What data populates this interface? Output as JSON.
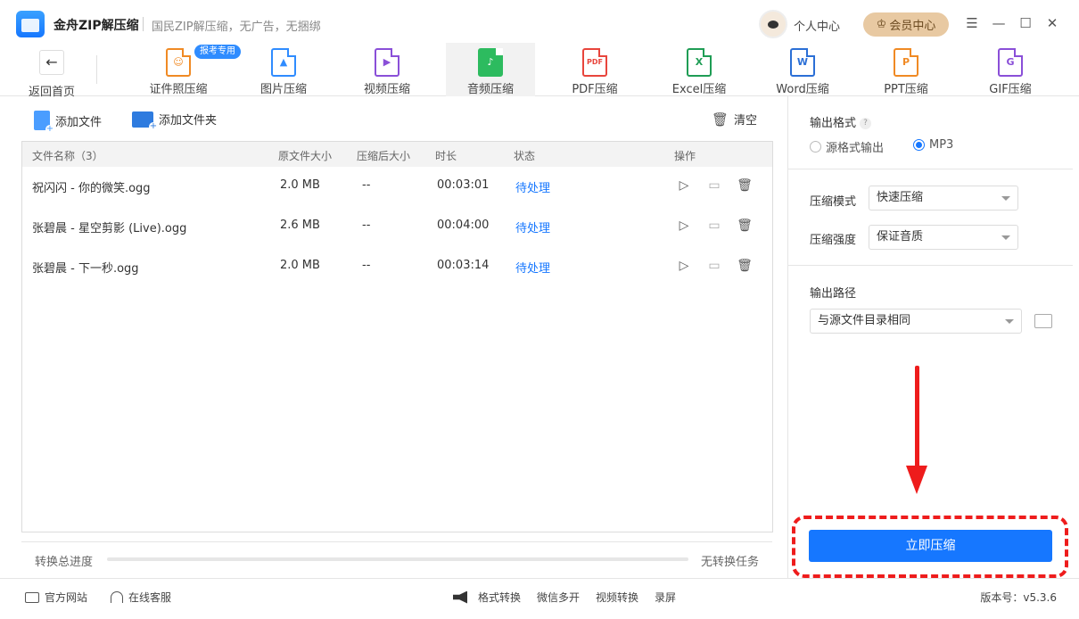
{
  "titlebar": {
    "app_name": "金舟ZIP解压缩",
    "slogan": "国民ZIP解压缩，无广告，无捆绑",
    "personal_center": "个人中心",
    "vip_center": "会员中心"
  },
  "toolnav": {
    "back_label": "返回首页",
    "badge": "报考专用",
    "tools": [
      {
        "label": "证件照压缩",
        "color": "#f08a24"
      },
      {
        "label": "图片压缩",
        "color": "#2f8cff"
      },
      {
        "label": "视频压缩",
        "color": "#8a4fd8"
      },
      {
        "label": "音频压缩",
        "color": "#2dbb5f"
      },
      {
        "label": "PDF压缩",
        "color": "#e8453c",
        "glyph": "PDF"
      },
      {
        "label": "Excel压缩",
        "color": "#1f9d55",
        "glyph": "X"
      },
      {
        "label": "Word压缩",
        "color": "#2b6fd6",
        "glyph": "W"
      },
      {
        "label": "PPT压缩",
        "color": "#f08a24",
        "glyph": "P"
      },
      {
        "label": "GIF压缩",
        "color": "#8a4fd8",
        "glyph": "G"
      }
    ]
  },
  "actions": {
    "add_file": "添加文件",
    "add_folder": "添加文件夹",
    "clear": "清空"
  },
  "table": {
    "headers": {
      "name": "文件名称（3）",
      "orig_size": "原文件大小",
      "comp_size": "压缩后大小",
      "duration": "时长",
      "status": "状态",
      "ops": "操作"
    },
    "rows": [
      {
        "name": "祝闪闪 - 你的微笑.ogg",
        "orig_size": "2.0 MB",
        "comp_size": "--",
        "duration": "00:03:01",
        "status": "待处理"
      },
      {
        "name": "张碧晨 - 星空剪影 (Live).ogg",
        "orig_size": "2.6 MB",
        "comp_size": "--",
        "duration": "00:04:00",
        "status": "待处理"
      },
      {
        "name": "张碧晨 - 下一秒.ogg",
        "orig_size": "2.0 MB",
        "comp_size": "--",
        "duration": "00:03:14",
        "status": "待处理"
      }
    ]
  },
  "progress": {
    "label": "转换总进度",
    "status": "无转换任务",
    "fraction": 0
  },
  "settings": {
    "output_format_title": "输出格式",
    "format_source": "源格式输出",
    "format_mp3": "MP3",
    "mode_label": "压缩模式",
    "mode_value": "快速压缩",
    "strength_label": "压缩强度",
    "strength_value": "保证音质",
    "path_title": "输出路径",
    "path_value": "与源文件目录相同",
    "compress_button": "立即压缩"
  },
  "footer": {
    "official_site": "官方网站",
    "online_service": "在线客服",
    "links": [
      "格式转换",
      "微信多开",
      "视频转换",
      "录屏"
    ],
    "version": "版本号：v5.3.6"
  },
  "colors": {
    "accent": "#1677ff",
    "annotation_red": "#ee1c1c"
  }
}
